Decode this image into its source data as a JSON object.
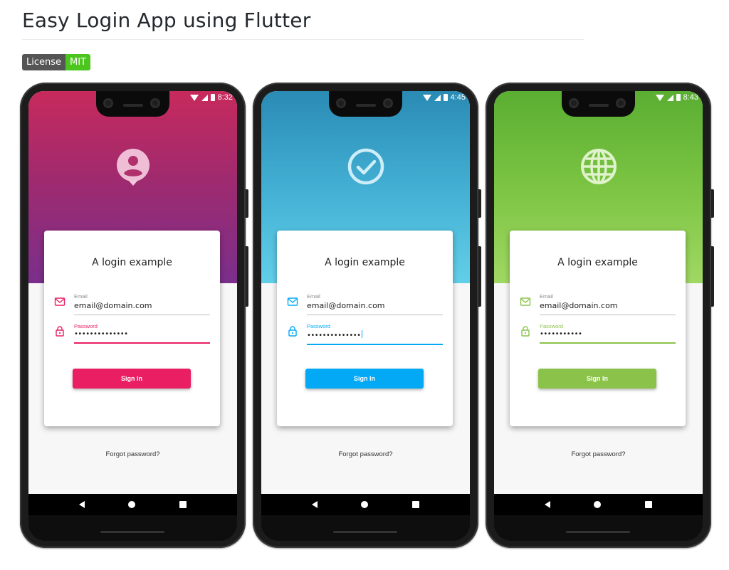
{
  "page": {
    "title": "Easy Login App using Flutter",
    "badge": {
      "label": "License",
      "value": "MIT",
      "label_color": "#555555",
      "value_color": "#4cc61e"
    }
  },
  "phones": [
    {
      "time": "8:32",
      "accent": "#e91e63",
      "gradient": [
        "#c2185b",
        "#7b2d8e"
      ],
      "hero_icon": "account-pin-icon",
      "card_title": "A login example",
      "email_label": "Email",
      "email_value": "email@domain.com",
      "password_label": "Password",
      "password_value": "••••••••••••••",
      "signin_label": "Sign In",
      "forgot_label": "Forgot password?"
    },
    {
      "time": "4:45",
      "accent": "#03a9f4",
      "gradient": [
        "#2b8fb8",
        "#5ac8e4"
      ],
      "hero_icon": "check-circle-icon",
      "card_title": "A login example",
      "email_label": "Email",
      "email_value": "email@domain.com",
      "password_label": "Password",
      "password_value": "••••••••••••••",
      "signin_label": "Sign In",
      "forgot_label": "Forgot password?"
    },
    {
      "time": "8:43",
      "accent": "#8bc34a",
      "gradient": [
        "#5bb033",
        "#9ed85e"
      ],
      "hero_icon": "globe-icon",
      "card_title": "A login example",
      "email_label": "Email",
      "email_value": "email@domain.com",
      "password_label": "Password",
      "password_value": "•••••••••••",
      "signin_label": "Sign In",
      "forgot_label": "Forgot password?"
    }
  ]
}
